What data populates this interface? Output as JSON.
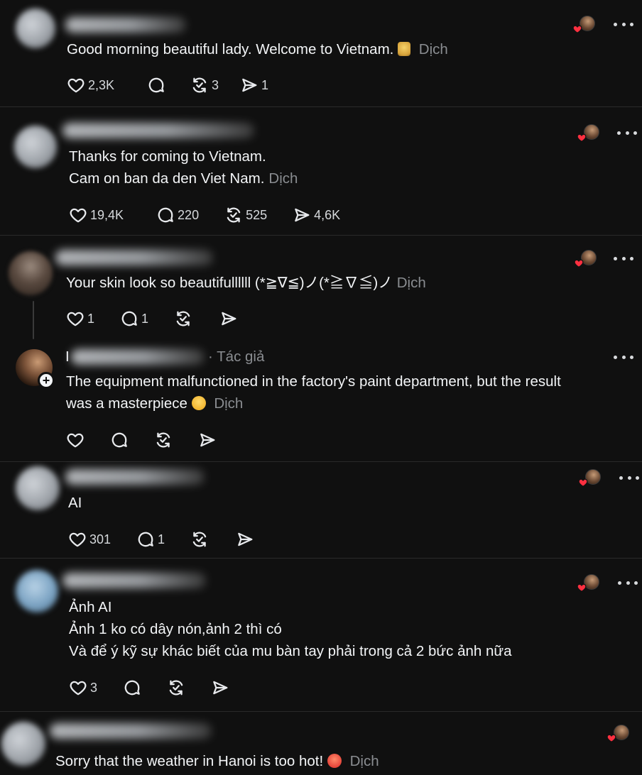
{
  "translate_label": "Dịch",
  "colors": {
    "background": "#101010",
    "text": "#f3f5f7",
    "muted": "#8a8d91",
    "heart": "#ff3040"
  },
  "comments": [
    {
      "lines": [
        "Good morning beautiful lady. Welcome to Vietnam."
      ],
      "emoji": "beer-icon",
      "actions": {
        "likes": "2,3K",
        "replies": "",
        "reposts": "3",
        "shares": "1"
      }
    },
    {
      "lines": [
        "Thanks for coming to Vietnam.",
        "Cam on ban da den Viet Nam."
      ],
      "actions": {
        "likes": "19,4K",
        "replies": "220",
        "reposts": "525",
        "shares": "4,6K"
      }
    },
    {
      "lines": [
        "Your skin look so beautifullllll (*≧∇≦)ノ(*≧∇≦)ノ"
      ],
      "actions": {
        "likes": "1",
        "replies": "1",
        "reposts": "",
        "shares": ""
      }
    },
    {
      "author_suffix": "· Tác giả",
      "author_initial": "I",
      "lines": [
        "The equipment malfunctioned in the factory's paint department, but the result",
        "was a masterpiece"
      ],
      "emoji": "grinning-face-icon",
      "actions": {
        "likes": "",
        "replies": "",
        "reposts": "",
        "shares": ""
      }
    },
    {
      "lines": [
        "AI"
      ],
      "actions": {
        "likes": "301",
        "replies": "1",
        "reposts": "",
        "shares": ""
      }
    },
    {
      "lines": [
        "Ảnh AI",
        "Ảnh 1 ko có dây nón,ảnh 2 thì có",
        "Và để ý kỹ sự khác biết của mu bàn tay phải trong cả 2 bức ảnh nữa"
      ],
      "actions": {
        "likes": "3",
        "replies": "",
        "reposts": "",
        "shares": ""
      }
    },
    {
      "lines": [
        "Sorry that the weather in Hanoi is too hot!"
      ],
      "emoji": "hot-face-icon",
      "actions": {}
    }
  ]
}
